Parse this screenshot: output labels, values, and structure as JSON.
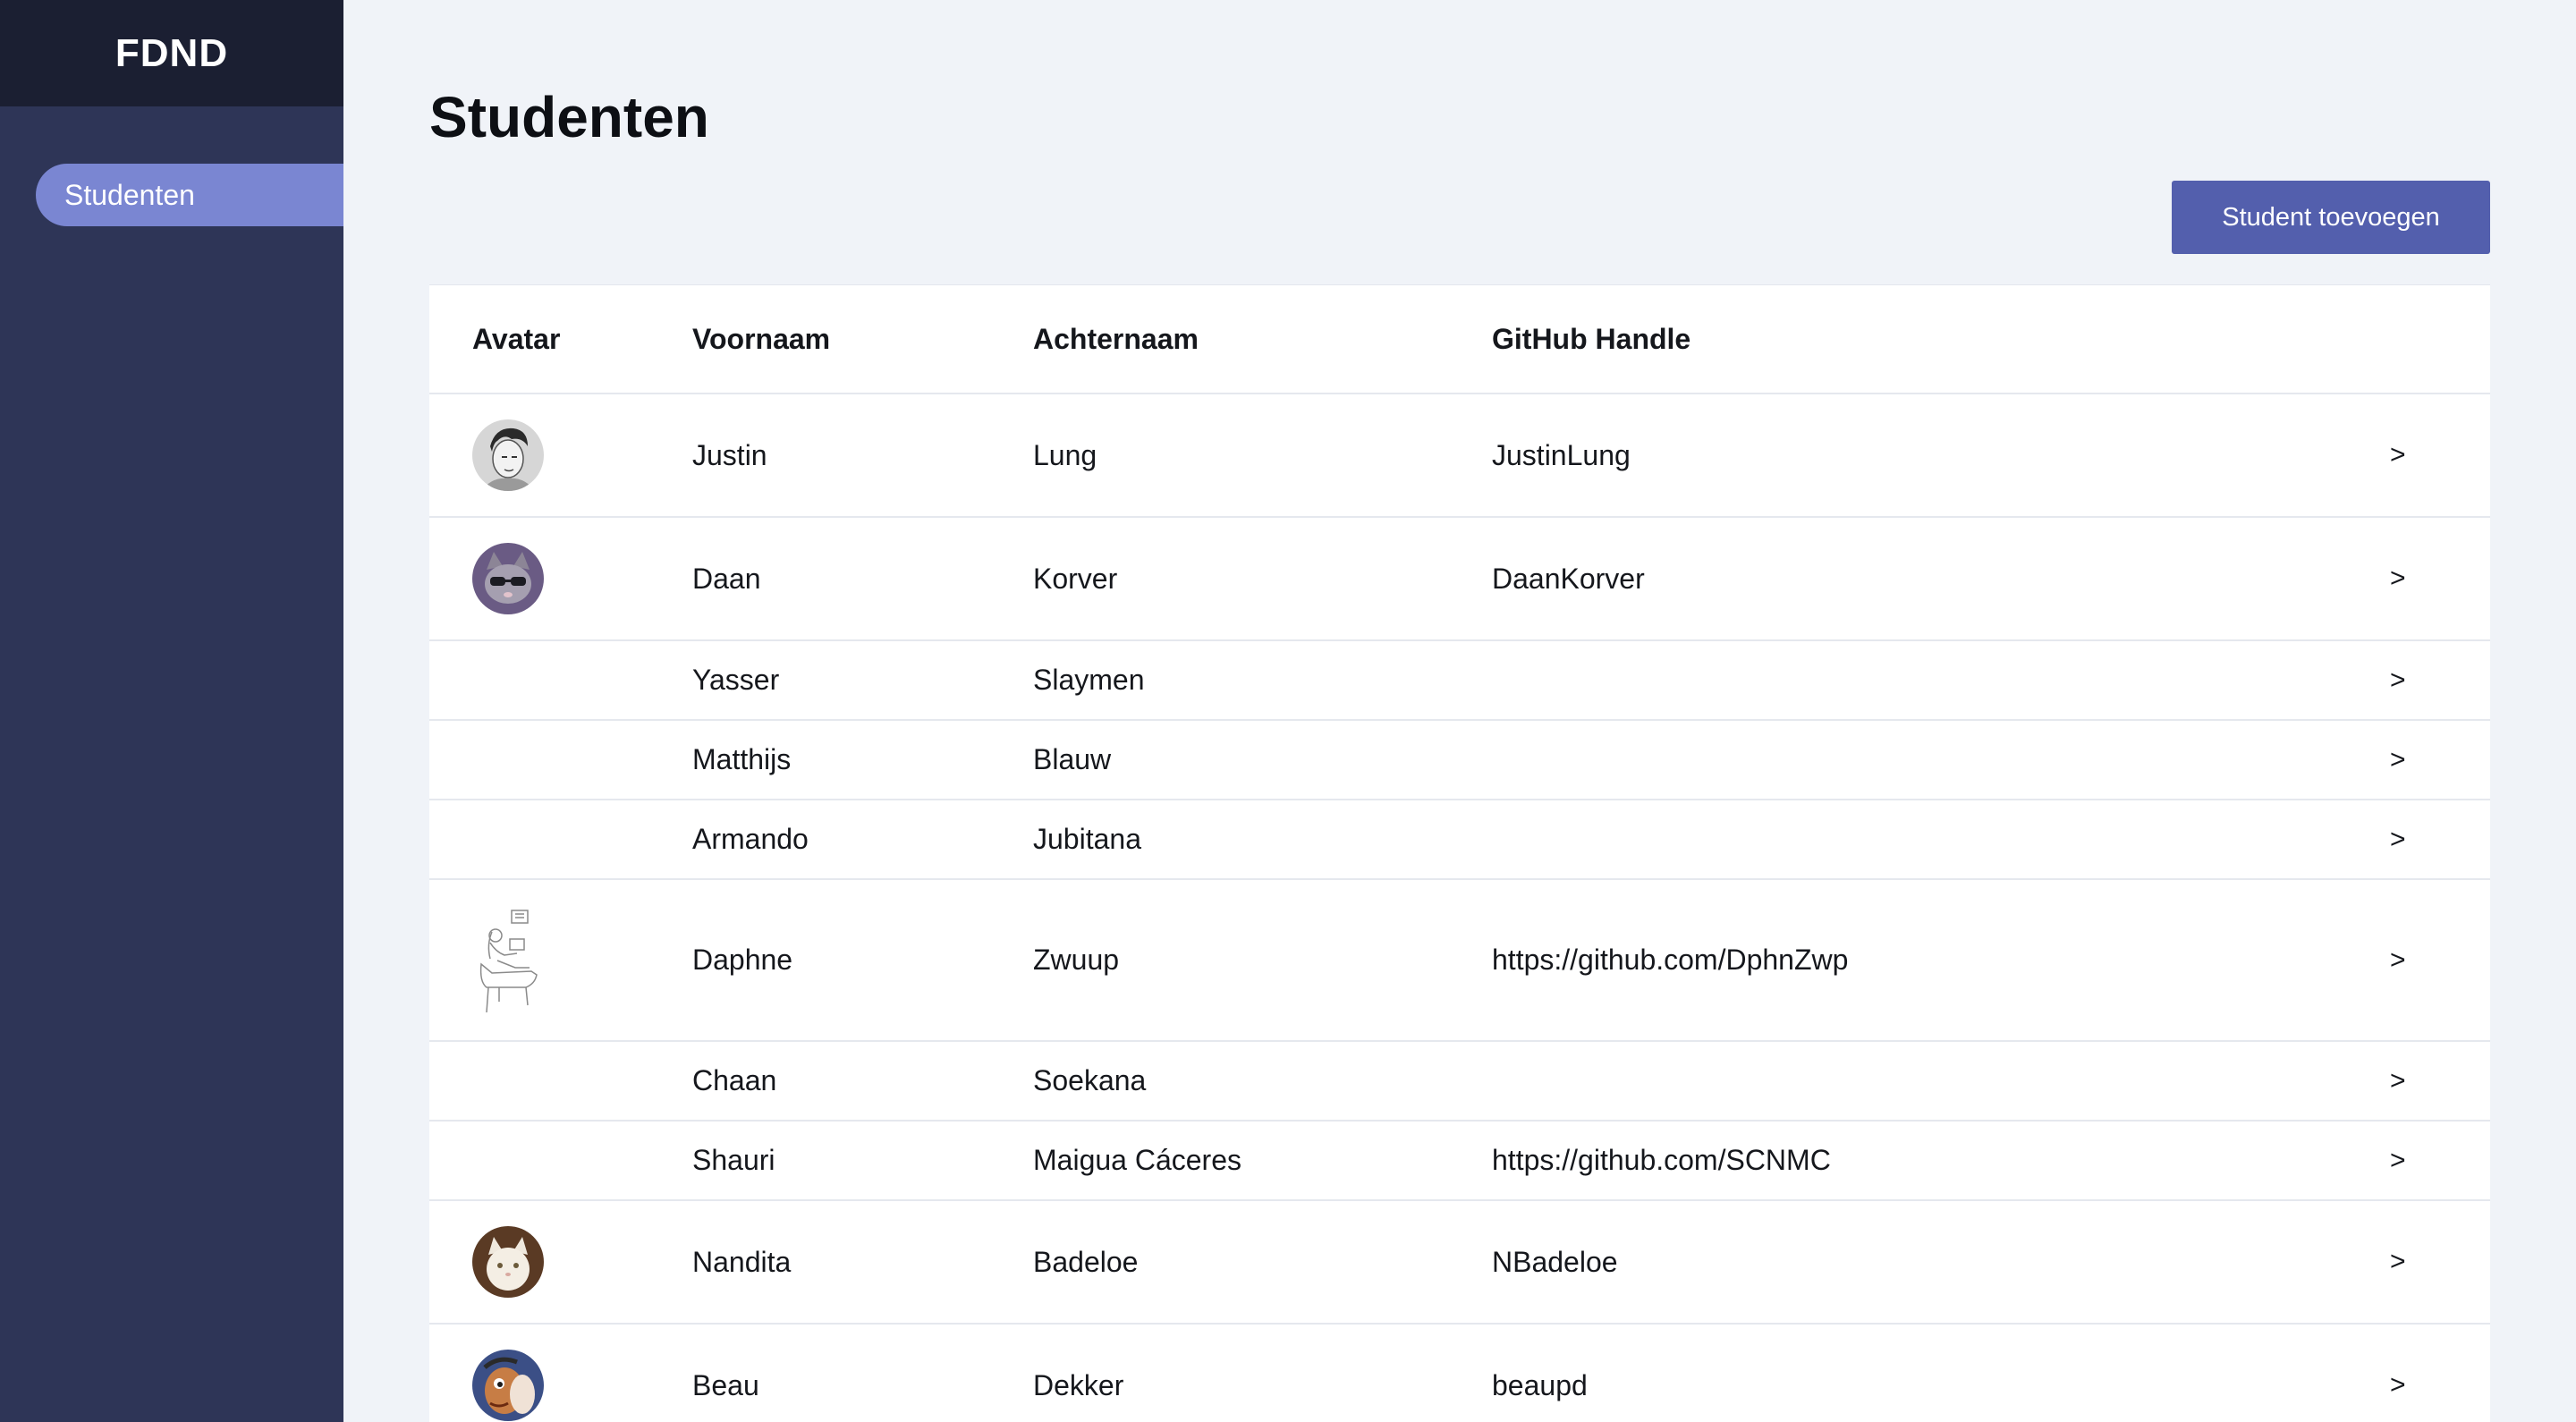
{
  "sidebar": {
    "brand": "FDND",
    "nav_items": [
      {
        "label": "Studenten",
        "active": true
      }
    ]
  },
  "main": {
    "title": "Studenten",
    "add_button_label": "Student toevoegen",
    "table": {
      "headers": [
        "Avatar",
        "Voornaam",
        "Achternaam",
        "GitHub Handle"
      ],
      "rows": [
        {
          "avatar": "portrait-sketch-photo",
          "first_name": "Justin",
          "last_name": "Lung",
          "github": "JustinLung",
          "go": ">"
        },
        {
          "avatar": "cat-with-sunglasses-photo",
          "first_name": "Daan",
          "last_name": "Korver",
          "github": "DaanKorver",
          "go": ">"
        },
        {
          "avatar": "",
          "first_name": "Yasser",
          "last_name": "Slaymen",
          "github": "",
          "go": ">"
        },
        {
          "avatar": "",
          "first_name": "Matthijs",
          "last_name": "Blauw",
          "github": "",
          "go": ">"
        },
        {
          "avatar": "",
          "first_name": "Armando",
          "last_name": "Jubitana",
          "github": "",
          "go": ">"
        },
        {
          "avatar": "line-drawing-person-at-desk",
          "first_name": "Daphne",
          "last_name": "Zwuup",
          "github": "https://github.com/DphnZwp",
          "go": ">"
        },
        {
          "avatar": "",
          "first_name": "Chaan",
          "last_name": "Soekana",
          "github": "",
          "go": ">"
        },
        {
          "avatar": "",
          "first_name": "Shauri",
          "last_name": "Maigua Cáceres",
          "github": "https://github.com/SCNMC",
          "go": ">"
        },
        {
          "avatar": "white-cat-photo",
          "first_name": "Nandita",
          "last_name": "Badeloe",
          "github": "NBadeloe",
          "go": ">"
        },
        {
          "avatar": "cartoon-character-photo",
          "first_name": "Beau",
          "last_name": "Dekker",
          "github": "beaupd",
          "go": ">"
        }
      ]
    }
  },
  "colors": {
    "sidebar_bg": "#2e3557",
    "brand_bg": "#1b1f32",
    "nav_active": "#7a86d2",
    "accent_button": "#535fad",
    "page_bg": "#f0f3f8"
  }
}
